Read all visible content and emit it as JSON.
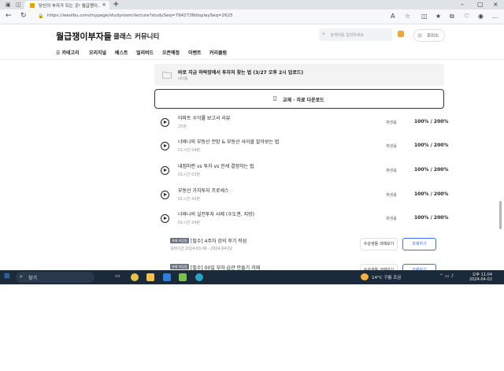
{
  "browser": {
    "tab_title": "당신의 부자가 되는 곳! 월급쟁이...",
    "url": "https://weolbu.com/mypage/studyroom/lecture?studySeq=7942738displaySeq=2625"
  },
  "site": {
    "logo": "월급쟁이부자들",
    "nav_class": "클래스",
    "nav_community": "커뮤니티",
    "search_placeholder": "검색어를 입력하세요",
    "user_name": "조이스",
    "menu": [
      "☰ 카테고리",
      "오리지널",
      "베스트",
      "얼리버드",
      "오픈예정",
      "이벤트",
      "커리큘럼"
    ]
  },
  "content": {
    "folder_title": "바로 지금 하락장에서 투자처 찾는 법 (3/27 오후 2시 업로드)",
    "folder_sub": "너나들",
    "download_label": "교재 · 자료 다운로드",
    "lectures": [
      {
        "title": "아파트 수익률 보고서 리뷰",
        "duration": "25분",
        "status": "재생률",
        "pct": "100% / 200%"
      },
      {
        "title": "너바나의 부동산 전망 & 부동산 사이클 알아보는 법",
        "duration": "01시간 04분",
        "status": "재생률",
        "pct": "100% / 200%"
      },
      {
        "title": "내집마련 vs 투자 vs 전세 결정하는 법",
        "duration": "01시간 03분",
        "status": "재생률",
        "pct": "100% / 200%"
      },
      {
        "title": "부동산 가치투자 프로세스",
        "duration": "01시간 42분",
        "status": "재생률",
        "pct": "100% / 200%"
      },
      {
        "title": "너바나의 실전투자 사례 (수도권, 지방)",
        "duration": "01시간 24분",
        "status": "재생률",
        "pct": "100% / 200%"
      }
    ],
    "assignments": [
      {
        "badge": "과제 마감됨",
        "title": "[필수] 4주차 강의 후기 작성",
        "period": "과제기간  2024.03.06 - 2024.04.02",
        "btn_secondary": "수강생들 과제보기",
        "btn_primary": "과제하기"
      },
      {
        "badge": "과제 마감됨",
        "title": "[필수] 00일 부자 습관 만들기 과제",
        "period": "",
        "btn_secondary": "수강생들 과제보기",
        "btn_primary": "과제하기"
      }
    ]
  },
  "taskbar": {
    "search": "찾기",
    "weather": "14°C  구름 조금",
    "time": "오후 11:04",
    "date": "2024-04-02"
  }
}
